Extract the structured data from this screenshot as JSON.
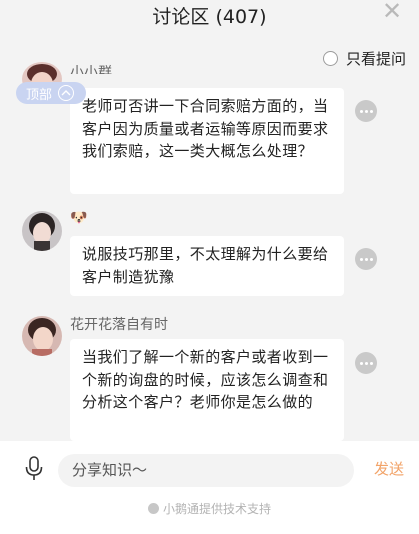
{
  "header": {
    "title": "讨论区 (407)",
    "close_icon": "close-icon"
  },
  "filter": {
    "label": "只看提问",
    "checked": false
  },
  "pinned": {
    "label": "顶部",
    "toggle_icon": "chevron-up-icon"
  },
  "messages": [
    {
      "name": "小小群",
      "text": "老师可否讲一下合同索赔方面的，当客户因为质量或者运输等原因而要求我们索赔，这一类大概怎么处理？"
    },
    {
      "name": "🐶",
      "text": "说服技巧那里，不太理解为什么要给客户制造犹豫"
    },
    {
      "name": "花开花落自有时",
      "text": "当我们了解一个新的客户或者收到一个新的询盘的时候，应该怎么调查和分析这个客户？老师你是怎么做的"
    }
  ],
  "composer": {
    "placeholder": "分享知识～",
    "send_label": "发送",
    "mic_icon": "microphone-icon"
  },
  "footer": {
    "text": "小鹅通提供技术支持"
  },
  "colors": {
    "background": "#f3f3f3",
    "send": "#f2a368",
    "pin_badge": "#c9d4f1"
  }
}
